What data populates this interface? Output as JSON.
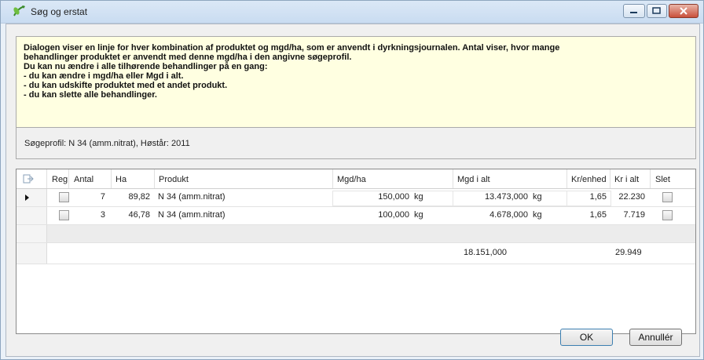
{
  "window": {
    "title": "Søg og erstat"
  },
  "info": {
    "lines": [
      "Dialogen viser en linje for hver kombination af produktet og mgd/ha, som er anvendt i dyrkningsjournalen. Antal viser, hvor mange",
      "behandlinger produktet er anvendt med denne mgd/ha i den angivne søgeprofil.",
      "Du kan nu ændre i alle tilhørende behandlinger på en gang:",
      "- du kan ændre i mgd/ha eller Mgd i alt.",
      "- du kan udskifte produktet med et andet produkt.",
      "- du kan slette alle behandlinger."
    ]
  },
  "profile": {
    "text": "Søgeprofil: N 34 (amm.nitrat), Høstår: 2011"
  },
  "grid": {
    "headers": {
      "reg": "Reg",
      "antal": "Antal",
      "ha": "Ha",
      "produkt": "Produkt",
      "mgd_ha": "Mgd/ha",
      "mgd_i_alt": "Mgd i alt",
      "kr_enhed": "Kr/enhed",
      "kr_i_alt": "Kr i alt",
      "slet": "Slet"
    },
    "rows": [
      {
        "antal": "7",
        "ha": "89,82",
        "produkt": "N 34 (amm.nitrat)",
        "mgd_ha": "150,000",
        "mgd_ha_unit": "kg",
        "mgd_i_alt": "13.473,000",
        "mgd_i_alt_unit": "kg",
        "kr_enhed": "1,65",
        "kr_i_alt": "22.230"
      },
      {
        "antal": "3",
        "ha": "46,78",
        "produkt": "N 34 (amm.nitrat)",
        "mgd_ha": "100,000",
        "mgd_ha_unit": "kg",
        "mgd_i_alt": "4.678,000",
        "mgd_i_alt_unit": "kg",
        "kr_enhed": "1,65",
        "kr_i_alt": "7.719"
      }
    ],
    "totals": {
      "mgd_i_alt": "18.151,000",
      "kr_i_alt": "29.949"
    }
  },
  "buttons": {
    "ok": "OK",
    "cancel": "Annullér"
  },
  "icons": {
    "title": "leaf-arrow-icon",
    "row_header": "row-pointer-icon",
    "header_corner": "export-icon"
  }
}
